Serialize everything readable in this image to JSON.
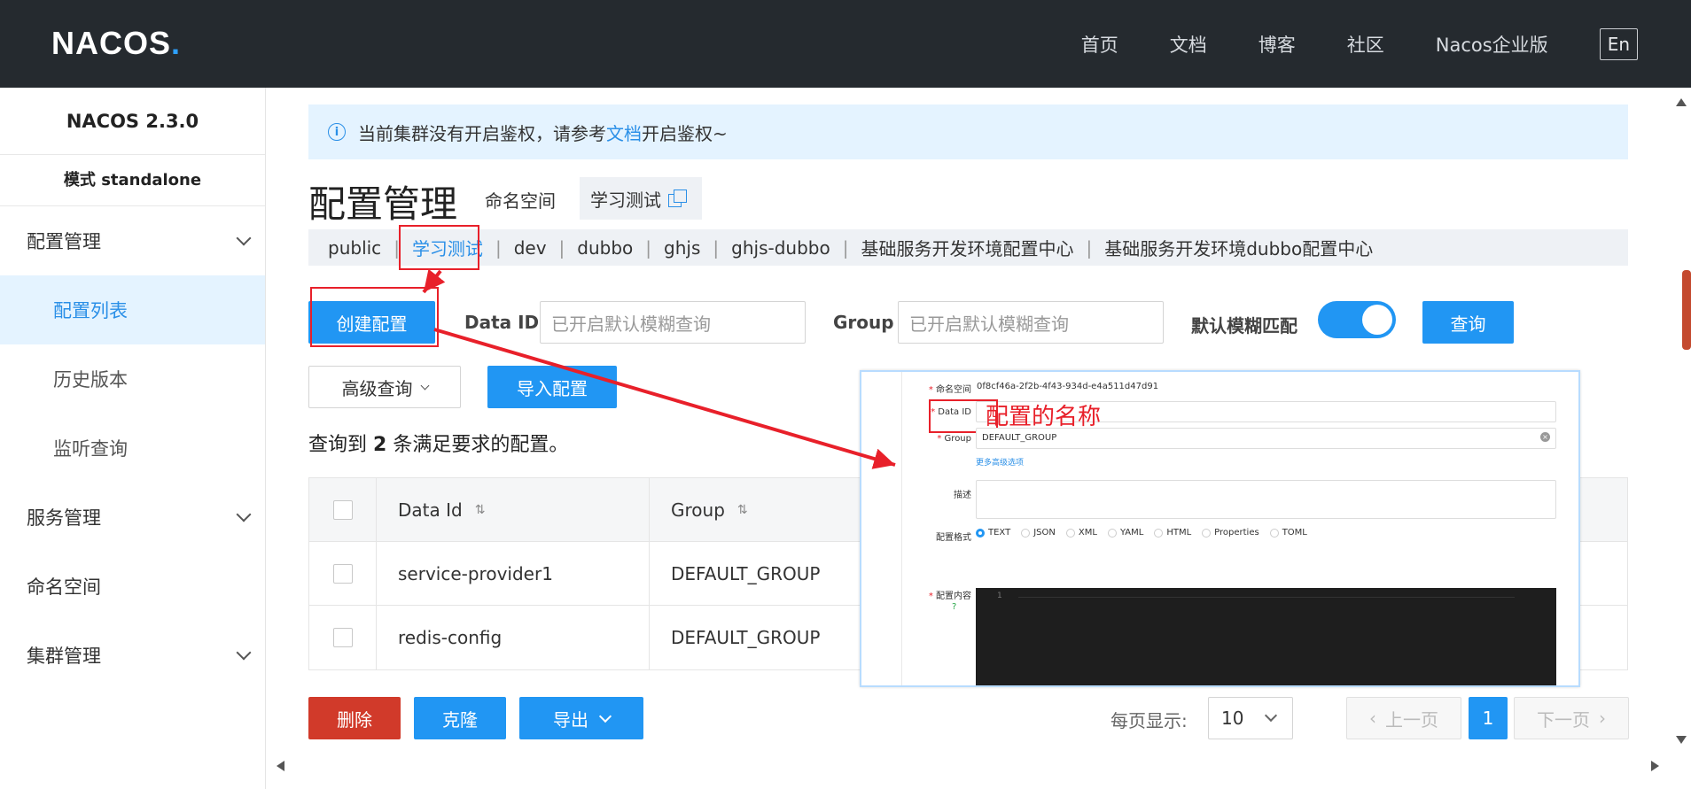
{
  "header": {
    "logo_main": "NACOS",
    "logo_dot": ".",
    "nav": [
      "首页",
      "文档",
      "博客",
      "社区",
      "Nacos企业版"
    ],
    "lang": "En"
  },
  "sidebar": {
    "version": "NACOS 2.3.0",
    "mode": "模式 standalone",
    "groups": [
      {
        "label": "配置管理",
        "children": [
          "配置列表",
          "历史版本",
          "监听查询"
        ]
      },
      {
        "label": "服务管理"
      },
      {
        "label": "命名空间"
      },
      {
        "label": "集群管理"
      }
    ]
  },
  "notice": {
    "prefix": "当前集群没有开启鉴权，请参考",
    "link": "文档",
    "suffix": "开启鉴权~"
  },
  "page": {
    "title": "配置管理",
    "ns_label": "命名空间",
    "ns_current": "学习测试"
  },
  "namespaces": [
    "public",
    "学习测试",
    "dev",
    "dubbo",
    "ghjs",
    "ghjs-dubbo",
    "基础服务开发环境配置中心",
    "基础服务开发环境dubbo配置中心"
  ],
  "toolbar": {
    "create": "创建配置",
    "dataid_label": "Data ID",
    "dataid_placeholder": "已开启默认模糊查询",
    "group_label": "Group",
    "group_placeholder": "已开启默认模糊查询",
    "fuzzy_label": "默认模糊匹配",
    "fuzzy_on": true,
    "query": "查询",
    "advanced": "高级查询",
    "import": "导入配置"
  },
  "result": {
    "prefix": "查询到",
    "count": "2",
    "suffix": "条满足要求的配置。"
  },
  "table": {
    "headers": [
      "Data Id",
      "Group"
    ],
    "rows": [
      {
        "data_id": "service-provider1",
        "group": "DEFAULT_GROUP"
      },
      {
        "data_id": "redis-config",
        "group": "DEFAULT_GROUP"
      }
    ]
  },
  "bottom": {
    "delete": "删除",
    "clone": "克隆",
    "export": "导出",
    "per_page_label": "每页显示:",
    "per_page": "10",
    "prev": "上一页",
    "current": "1",
    "next": "下一页"
  },
  "inset": {
    "ns_label": "命名空间",
    "ns_value": "0f8cf46a-2f2b-4f43-934d-e4a511d47d91",
    "dataid_label": "Data ID",
    "group_label": "Group",
    "group_value": "DEFAULT_GROUP",
    "more_link": "更多高级选项",
    "desc_label": "描述",
    "format_label": "配置格式",
    "formats": [
      "TEXT",
      "JSON",
      "XML",
      "YAML",
      "HTML",
      "Properties",
      "TOML"
    ],
    "content_label": "配置内容",
    "line_no": "1",
    "annotation": "配置的名称"
  },
  "colors": {
    "primary": "#2196f3",
    "danger": "#d13a2a",
    "annotation": "#e8202a",
    "header_bg": "#252a2f"
  }
}
